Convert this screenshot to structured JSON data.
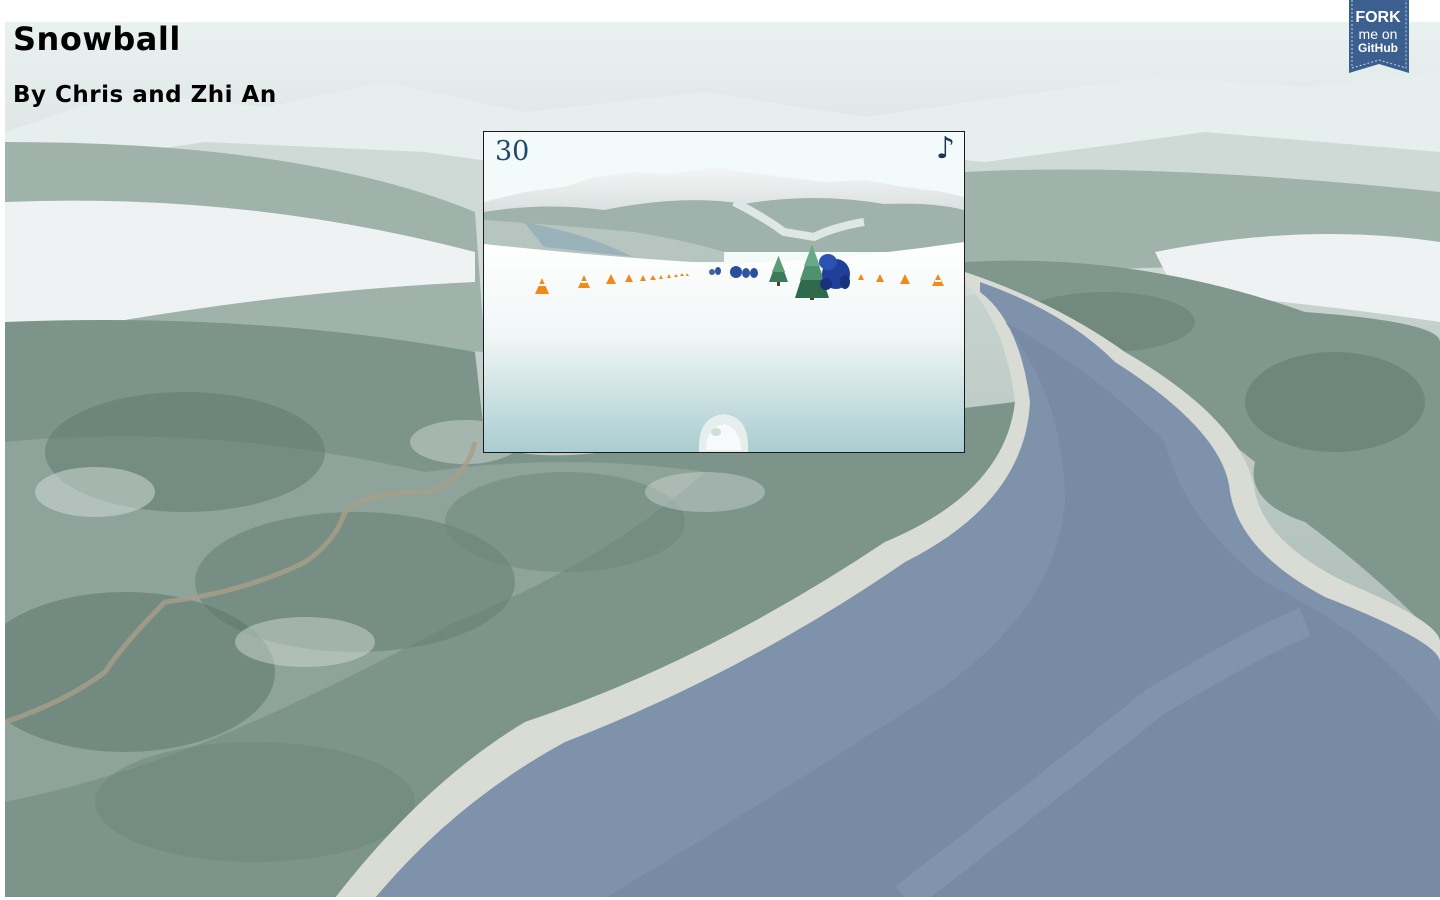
{
  "page": {
    "title": "Snowball",
    "subtitle": "By Chris and Zhi An"
  },
  "fork_ribbon": {
    "line1": "FORK",
    "line2": "me on",
    "line3": "GitHub",
    "color": "#3b5f8f"
  },
  "game": {
    "score": "30",
    "music_icon": "♪",
    "colors": {
      "score_text": "#1d4a6b",
      "snow": "#f2f7f7",
      "cone": "#f08a1c",
      "tree": "#3d7a5a",
      "creature": "#1f3f9a"
    }
  },
  "icons": {
    "music": "music-note-icon",
    "ribbon": "github-ribbon-icon"
  }
}
